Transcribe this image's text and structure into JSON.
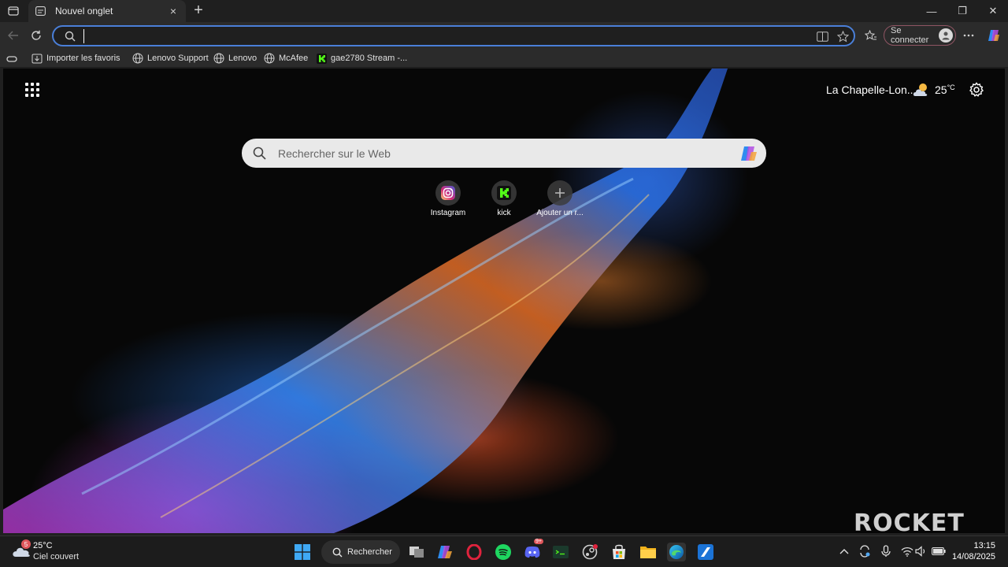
{
  "browser": {
    "tab": {
      "title": "Nouvel onglet",
      "close": "×"
    },
    "new_tab": "+",
    "window": {
      "minimize": "—",
      "maximize": "❐",
      "close": "✕"
    },
    "address": {
      "value": "",
      "placeholder": ""
    },
    "signin_label": "Se connecter"
  },
  "favorites": [
    {
      "label": "Importer les favoris",
      "icon": "import-icon"
    },
    {
      "label": "Lenovo Support",
      "icon": "globe-icon"
    },
    {
      "label": "Lenovo",
      "icon": "globe-icon"
    },
    {
      "label": "McAfee",
      "icon": "globe-icon"
    },
    {
      "label": "gae2780 Stream -...",
      "icon": "kick-icon"
    }
  ],
  "newtab": {
    "weather_location": "La Chapelle-Lon...",
    "weather_temp": "25",
    "weather_unit": "°C",
    "search_placeholder": "Rechercher sur le Web",
    "tiles": [
      {
        "label": "Instagram",
        "icon": "instagram-icon"
      },
      {
        "label": "kick",
        "icon": "kick-icon"
      },
      {
        "label": "Ajouter un r...",
        "icon": "plus-icon"
      }
    ],
    "watermark": "ROCKET"
  },
  "taskbar": {
    "weather_temp": "25°C",
    "weather_condition": "Ciel couvert",
    "weather_badge": "5",
    "search_label": "Rechercher",
    "discord_badge": "9+",
    "time": "13:15",
    "date": "14/08/2025"
  },
  "colors": {
    "accent": "#4a7fd8",
    "signin_border": "#8f5563",
    "kick_green": "#53fc18"
  }
}
